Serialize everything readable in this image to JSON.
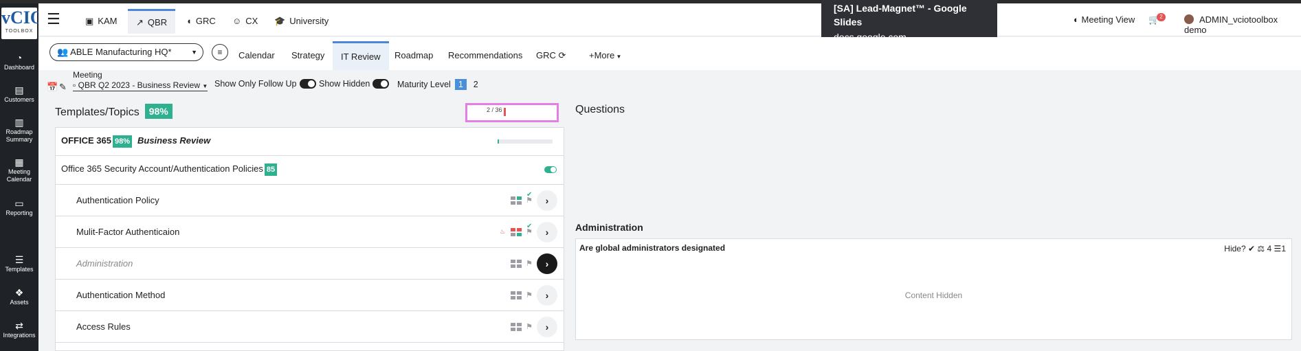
{
  "logo": {
    "big": "vCIO",
    "small": "TOOLBOX"
  },
  "sidebar": {
    "items": [
      {
        "label": "Dashboard",
        "icon": "gauge-icon"
      },
      {
        "label": "Customers",
        "icon": "id-card-icon"
      },
      {
        "label": "Roadmap Summary",
        "icon": "map-icon"
      },
      {
        "label": "Meeting Calendar",
        "icon": "calendar-icon"
      },
      {
        "label": "Reporting",
        "icon": "report-icon"
      },
      {
        "label": "Templates",
        "icon": "layers-icon"
      },
      {
        "label": "Assets",
        "icon": "cubes-icon"
      },
      {
        "label": "Integrations",
        "icon": "shuffle-icon"
      }
    ]
  },
  "topnav": {
    "tabs": [
      {
        "label": "KAM",
        "icon": "▣"
      },
      {
        "label": "QBR",
        "icon": "↗"
      },
      {
        "label": "GRC",
        "icon": "◖"
      },
      {
        "label": "CX",
        "icon": "☺"
      },
      {
        "label": "University",
        "icon": "🎓"
      }
    ],
    "meeting_view": "Meeting View",
    "notif_count": "2",
    "user": "ADMIN_vciotoolbox demo"
  },
  "tooltip": {
    "title": "[SA] Lead-Magnet™ - Google Slides",
    "url": "docs.google.com"
  },
  "subnav": {
    "customer": "ABLE Manufacturing HQ*",
    "tabs": [
      "Calendar",
      "Strategy",
      "IT Review",
      "Roadmap",
      "Recommendations",
      "GRC",
      "+More"
    ]
  },
  "meeting": {
    "label": "Meeting",
    "value": "QBR Q2 2023 - Business Review",
    "follow_up": "Show Only Follow Up",
    "show_hidden": "Show Hidden",
    "maturity": "Maturity Level",
    "level1": "1",
    "level2": "2"
  },
  "left": {
    "title": "Templates/Topics",
    "pct": "98%",
    "progress_text": "2 / 36",
    "progress": 0.06,
    "office": {
      "name": "OFFICE 365",
      "pct": "98%",
      "subtitle": "Business Review",
      "progress": 0.03
    },
    "policy": {
      "name": "Office 365 Security Account/Authentication Policies",
      "score": "85"
    },
    "items": [
      {
        "label": "Authentication Policy"
      },
      {
        "label": "Mulit-Factor Authenticaion"
      },
      {
        "label": "Administration"
      },
      {
        "label": "Authentication Method"
      },
      {
        "label": "Access Rules"
      }
    ]
  },
  "right": {
    "questions_title": "Questions",
    "section_title": "Administration",
    "question": "Are global administrators designated",
    "hide": "Hide?",
    "weight": "4",
    "count": "1",
    "content_hidden": "Content Hidden"
  }
}
